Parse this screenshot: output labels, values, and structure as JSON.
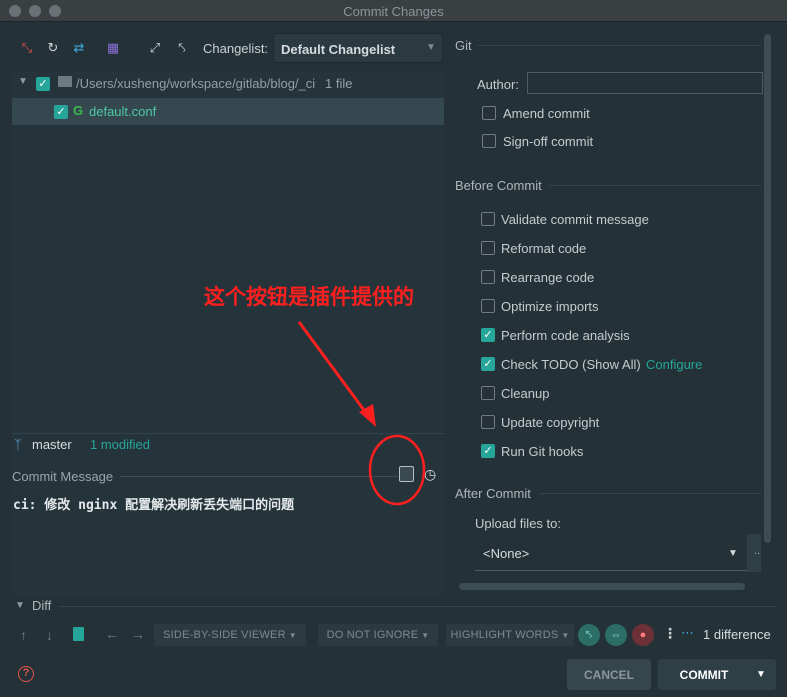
{
  "window": {
    "title": "Commit Changes"
  },
  "toolbar": {
    "changelist_label": "Changelist:",
    "changelist_value": "Default Changelist"
  },
  "tree": {
    "root_path": "/Users/xusheng/workspace/gitlab/blog/_ci",
    "root_count": "1 file",
    "file_name": "default.conf"
  },
  "status": {
    "branch": "master",
    "modified": "1 modified"
  },
  "commit_message": {
    "label": "Commit Message",
    "text": "ci: 修改 nginx 配置解决刷新丢失端口的问题"
  },
  "annotation": {
    "text": "这个按钮是插件提供的",
    "color": "#ff1f1f"
  },
  "git": {
    "section_title": "Git",
    "author_label": "Author:",
    "author_value": "",
    "amend_label": "Amend commit",
    "signoff_label": "Sign-off commit"
  },
  "before_commit": {
    "title": "Before Commit",
    "options": [
      {
        "label": "Validate commit message",
        "checked": false
      },
      {
        "label": "Reformat code",
        "checked": false
      },
      {
        "label": "Rearrange code",
        "checked": false
      },
      {
        "label": "Optimize imports",
        "checked": false
      },
      {
        "label": "Perform code analysis",
        "checked": true
      },
      {
        "label": "Check TODO (Show All)",
        "checked": true,
        "link": "Configure"
      },
      {
        "label": "Cleanup",
        "checked": false
      },
      {
        "label": "Update copyright",
        "checked": false
      },
      {
        "label": "Run Git hooks",
        "checked": true
      }
    ]
  },
  "after_commit": {
    "title": "After Commit",
    "upload_label": "Upload files to:",
    "upload_value": "<None>",
    "more_label": ".."
  },
  "diff": {
    "title": "Diff",
    "viewer": "SIDE-BY-SIDE VIEWER",
    "ignore": "DO NOT IGNORE",
    "highlight": "HIGHLIGHT WORDS",
    "count": "1 difference"
  },
  "footer": {
    "cancel": "CANCEL",
    "commit": "COMMIT"
  },
  "colors": {
    "accent": "#26a69a",
    "link": "#26a69a",
    "background": "#243238"
  }
}
